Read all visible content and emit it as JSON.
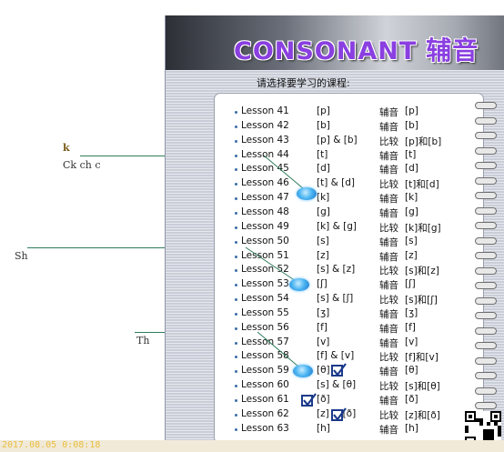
{
  "annotations": [
    {
      "text": "k"
    },
    {
      "text": "Ck ch c"
    },
    {
      "text": "Sh"
    },
    {
      "text": "Th"
    }
  ],
  "header": {
    "title": "CONSONANT",
    "title_cn": "辅音",
    "title_color": "#8a3fe0"
  },
  "prompt": "请选择要学习的课程:",
  "lessons": [
    {
      "lesson": "Lesson 41",
      "symbol": "[p]",
      "type": "辅音",
      "detail": "[p]"
    },
    {
      "lesson": "Lesson 42",
      "symbol": "[b]",
      "type": "辅音",
      "detail": "[b]"
    },
    {
      "lesson": "Lesson 43",
      "symbol": "[p] & [b]",
      "type": "比较",
      "detail": "[p]和[b]"
    },
    {
      "lesson": "Lesson 44",
      "symbol": "[t]",
      "type": "辅音",
      "detail": "[t]"
    },
    {
      "lesson": "Lesson 45",
      "symbol": "[d]",
      "type": "辅音",
      "detail": "[d]"
    },
    {
      "lesson": "Lesson 46",
      "symbol": "[t] & [d]",
      "type": "比较",
      "detail": "[t]和[d]"
    },
    {
      "lesson": "Lesson 47",
      "symbol": "[k]",
      "type": "辅音",
      "detail": "[k]"
    },
    {
      "lesson": "Lesson 48",
      "symbol": "[g]",
      "type": "辅音",
      "detail": "[g]"
    },
    {
      "lesson": "Lesson 49",
      "symbol": "[k] & [g]",
      "type": "比较",
      "detail": "[k]和[g]"
    },
    {
      "lesson": "Lesson 50",
      "symbol": "[s]",
      "type": "辅音",
      "detail": "[s]"
    },
    {
      "lesson": "Lesson 51",
      "symbol": "[z]",
      "type": "辅音",
      "detail": "[z]"
    },
    {
      "lesson": "Lesson 52",
      "symbol": "[s] & [z]",
      "type": "比较",
      "detail": "[s]和[z]"
    },
    {
      "lesson": "Lesson 53",
      "symbol": "[ʃ]",
      "type": "辅音",
      "detail": "[ʃ]"
    },
    {
      "lesson": "Lesson 54",
      "symbol": "[s] & [ʃ]",
      "type": "比较",
      "detail": "[s]和[ʃ]"
    },
    {
      "lesson": "Lesson 55",
      "symbol": "[ʒ]",
      "type": "辅音",
      "detail": "[ʒ]"
    },
    {
      "lesson": "Lesson 56",
      "symbol": "[f]",
      "type": "辅音",
      "detail": "[f]"
    },
    {
      "lesson": "Lesson 57",
      "symbol": "[v]",
      "type": "辅音",
      "detail": "[v]"
    },
    {
      "lesson": "Lesson 58",
      "symbol": "[f] & [v]",
      "type": "比较",
      "detail": "[f]和[v]"
    },
    {
      "lesson": "Lesson 59",
      "symbol": "[θ]",
      "type": "辅音",
      "detail": "[θ]"
    },
    {
      "lesson": "Lesson 60",
      "symbol": "[s] & [θ]",
      "type": "比较",
      "detail": "[s]和[θ]"
    },
    {
      "lesson": "Lesson 61",
      "symbol": "[ð]",
      "type": "辅音",
      "detail": "[ð]"
    },
    {
      "lesson": "Lesson 62",
      "symbol": "[z] & [ð]",
      "type": "比较",
      "detail": "[z]和[ð]"
    },
    {
      "lesson": "Lesson 63",
      "symbol": "[h]",
      "type": "辅音",
      "detail": "[h]"
    }
  ],
  "timestamp": "2017.08.05  0:08:18",
  "icons": {
    "bubble": "blue-bubble-icon",
    "check": "checkbox-icon",
    "qr": "qr-code-icon",
    "ring": "binder-ring-icon"
  },
  "colors": {
    "annotation_line": "#2e7d5b",
    "bullet": "#3b6ea5",
    "timestamp_text": "#e9bd3c"
  }
}
